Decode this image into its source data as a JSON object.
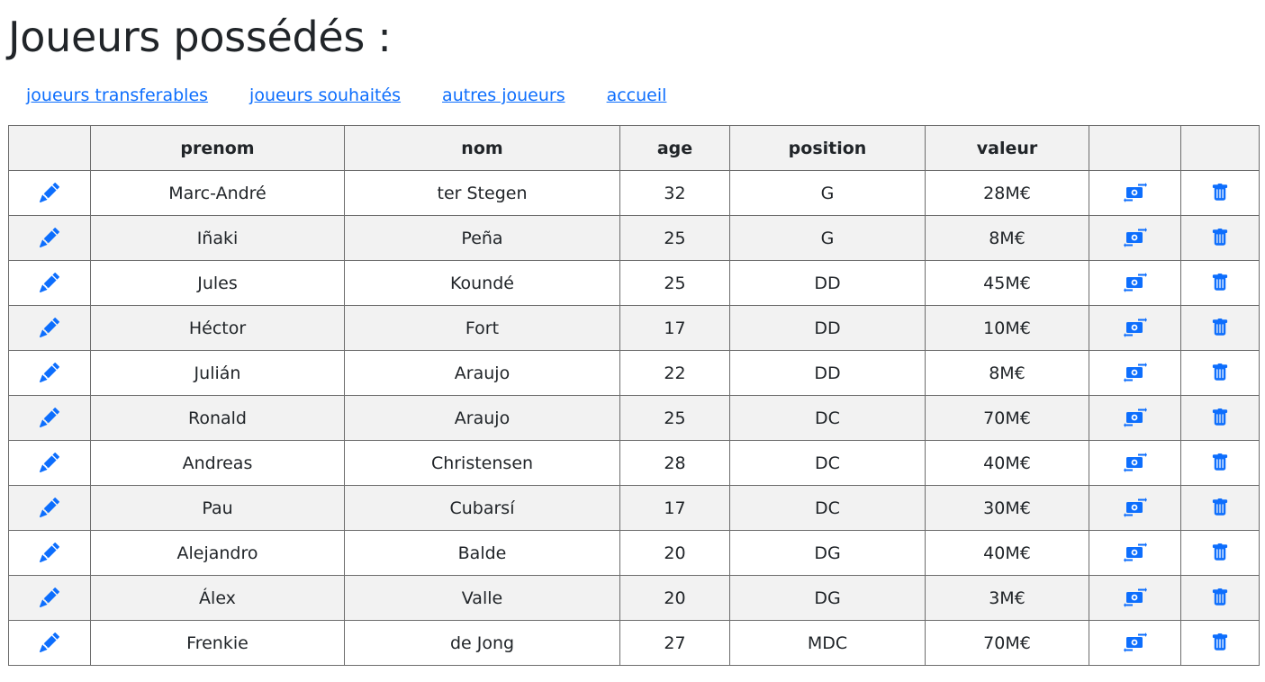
{
  "page": {
    "title": "Joueurs possédés :"
  },
  "nav": {
    "links": [
      {
        "label": "joueurs transferables"
      },
      {
        "label": "joueurs souhaités"
      },
      {
        "label": "autres joueurs"
      },
      {
        "label": "accueil"
      }
    ]
  },
  "table": {
    "headers": [
      "",
      "prenom",
      "nom",
      "age",
      "position",
      "valeur",
      "",
      ""
    ],
    "row_icons": {
      "edit": "pencil-icon",
      "transfer": "money-transfer-icon",
      "delete": "trash-icon"
    },
    "rows": [
      {
        "prenom": "Marc-André",
        "nom": "ter Stegen",
        "age": "32",
        "position": "G",
        "valeur": "28M€"
      },
      {
        "prenom": "Iñaki",
        "nom": "Peña",
        "age": "25",
        "position": "G",
        "valeur": "8M€"
      },
      {
        "prenom": "Jules",
        "nom": "Koundé",
        "age": "25",
        "position": "DD",
        "valeur": "45M€"
      },
      {
        "prenom": "Héctor",
        "nom": "Fort",
        "age": "17",
        "position": "DD",
        "valeur": "10M€"
      },
      {
        "prenom": "Julián",
        "nom": "Araujo",
        "age": "22",
        "position": "DD",
        "valeur": "8M€"
      },
      {
        "prenom": "Ronald",
        "nom": "Araujo",
        "age": "25",
        "position": "DC",
        "valeur": "70M€"
      },
      {
        "prenom": "Andreas",
        "nom": "Christensen",
        "age": "28",
        "position": "DC",
        "valeur": "40M€"
      },
      {
        "prenom": "Pau",
        "nom": "Cubarsí",
        "age": "17",
        "position": "DC",
        "valeur": "30M€"
      },
      {
        "prenom": "Alejandro",
        "nom": "Balde",
        "age": "20",
        "position": "DG",
        "valeur": "40M€"
      },
      {
        "prenom": "Álex",
        "nom": "Valle",
        "age": "20",
        "position": "DG",
        "valeur": "3M€"
      },
      {
        "prenom": "Frenkie",
        "nom": "de Jong",
        "age": "27",
        "position": "MDC",
        "valeur": "70M€"
      }
    ]
  },
  "colors": {
    "accent": "#0d6efd",
    "stripe": "#f2f2f2",
    "border": "#6c6c6c"
  }
}
